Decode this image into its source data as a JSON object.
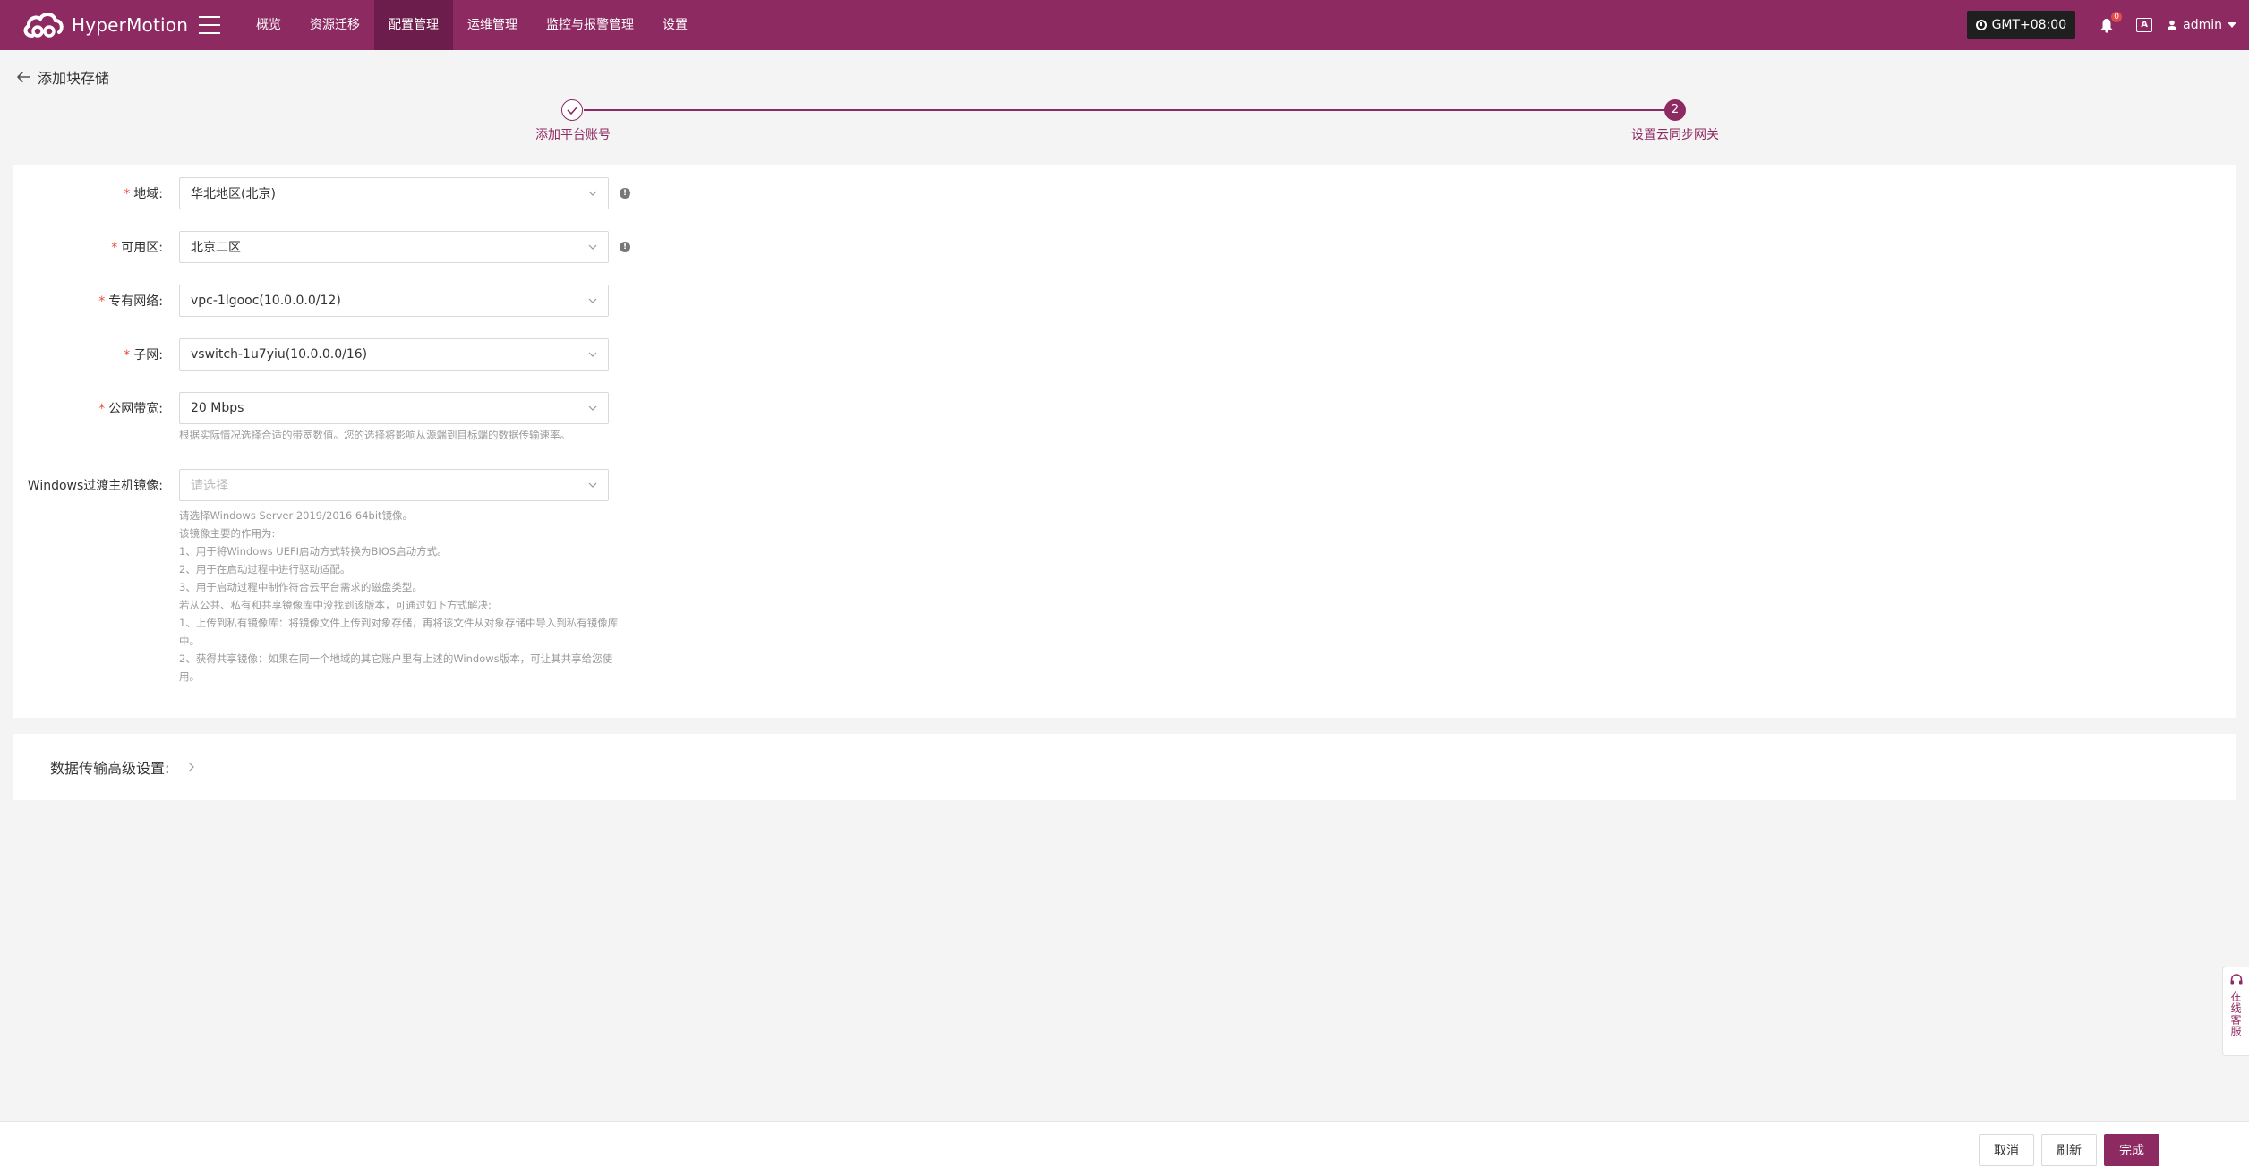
{
  "app": {
    "brand": "HyperMotion"
  },
  "nav": {
    "items": [
      {
        "label": "概览"
      },
      {
        "label": "资源迁移"
      },
      {
        "label": "配置管理"
      },
      {
        "label": "运维管理"
      },
      {
        "label": "监控与报警管理"
      },
      {
        "label": "设置"
      }
    ],
    "active_index": 2
  },
  "header_right": {
    "timezone": "GMT+08:00",
    "notification_count": "0",
    "translate_label": "A",
    "user": "admin"
  },
  "page": {
    "back_label": "添加块存储"
  },
  "steps": [
    {
      "label": "添加平台账号",
      "status": "done"
    },
    {
      "label": "设置云同步网关",
      "number": "2",
      "status": "current"
    }
  ],
  "form": {
    "region": {
      "label": "地域:",
      "value": "华北地区(北京)"
    },
    "zone": {
      "label": "可用区:",
      "value": "北京二区"
    },
    "vpc": {
      "label": "专有网络:",
      "value": "vpc-1lgooc(10.0.0.0/12)"
    },
    "subnet": {
      "label": "子网:",
      "value": "vswitch-1u7yiu(10.0.0.0/16)"
    },
    "bandwidth": {
      "label": "公网带宽:",
      "value": "20 Mbps",
      "hint": "根据实际情况选择合适的带宽数值。您的选择将影响从源端到目标端的数据传输速率。"
    },
    "windows_image": {
      "label": "Windows过渡主机镜像:",
      "placeholder": "请选择",
      "help": [
        "请选择Windows Server 2019/2016 64bit镜像。",
        "该镜像主要的作用为:",
        "1、用于将Windows UEFI启动方式转换为BIOS启动方式。",
        "2、用于在启动过程中进行驱动适配。",
        "3、用于启动过程中制作符合云平台需求的磁盘类型。",
        "若从公共、私有和共享镜像库中没找到该版本，可通过如下方式解决:",
        "1、上传到私有镜像库：将镜像文件上传到对象存储，再将该文件从对象存储中导入到私有镜像库中。",
        "2、获得共享镜像：如果在同一个地域的其它账户里有上述的Windows版本，可让其共享给您使用。"
      ]
    }
  },
  "advanced": {
    "label": "数据传输高级设置:"
  },
  "footer": {
    "cancel": "取消",
    "refresh": "刷新",
    "finish": "完成"
  },
  "service": {
    "label": "在线客服"
  },
  "colors": {
    "brand": "#8d2a62",
    "brand_dark": "#6d1d4b",
    "required": "#e74c3c"
  }
}
